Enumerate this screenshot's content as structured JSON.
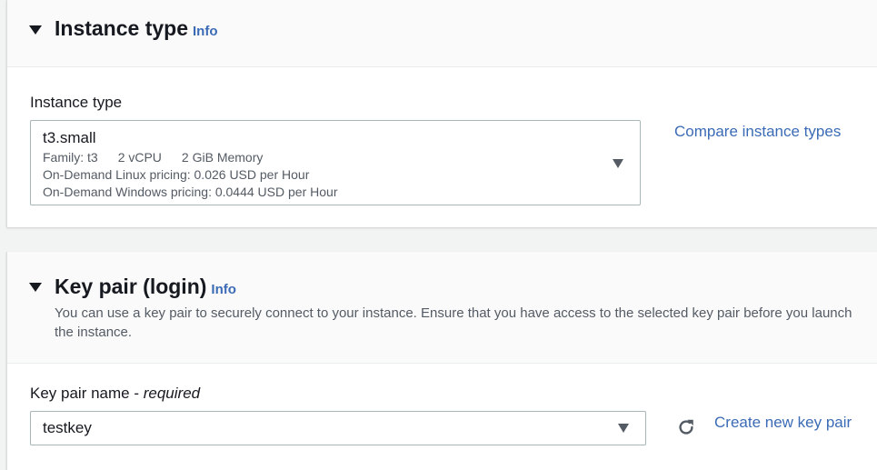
{
  "instance_type_section": {
    "title": "Instance type",
    "info": "Info",
    "field_label": "Instance type",
    "selected": {
      "name": "t3.small",
      "family": "Family: t3",
      "vcpu": "2 vCPU",
      "memory": "2 GiB Memory",
      "linux_pricing": "On-Demand Linux pricing: 0.026 USD per Hour",
      "windows_pricing": "On-Demand Windows pricing: 0.0444 USD per Hour"
    },
    "compare_link": "Compare instance types"
  },
  "key_pair_section": {
    "title": "Key pair (login)",
    "info": "Info",
    "description": "You can use a key pair to securely connect to your instance. Ensure that you have access to the selected key pair before you launch the instance.",
    "field_label": "Key pair name",
    "required_suffix": "required",
    "selected": "testkey",
    "create_link": "Create new key pair"
  },
  "icons": {
    "collapse": "caret-down-icon",
    "dropdown": "chevron-down-icon",
    "refresh": "refresh-icon"
  },
  "colors": {
    "link": "#3b6bb5",
    "text": "#16191f",
    "muted": "#545b64",
    "background": "#f2f3f3"
  }
}
